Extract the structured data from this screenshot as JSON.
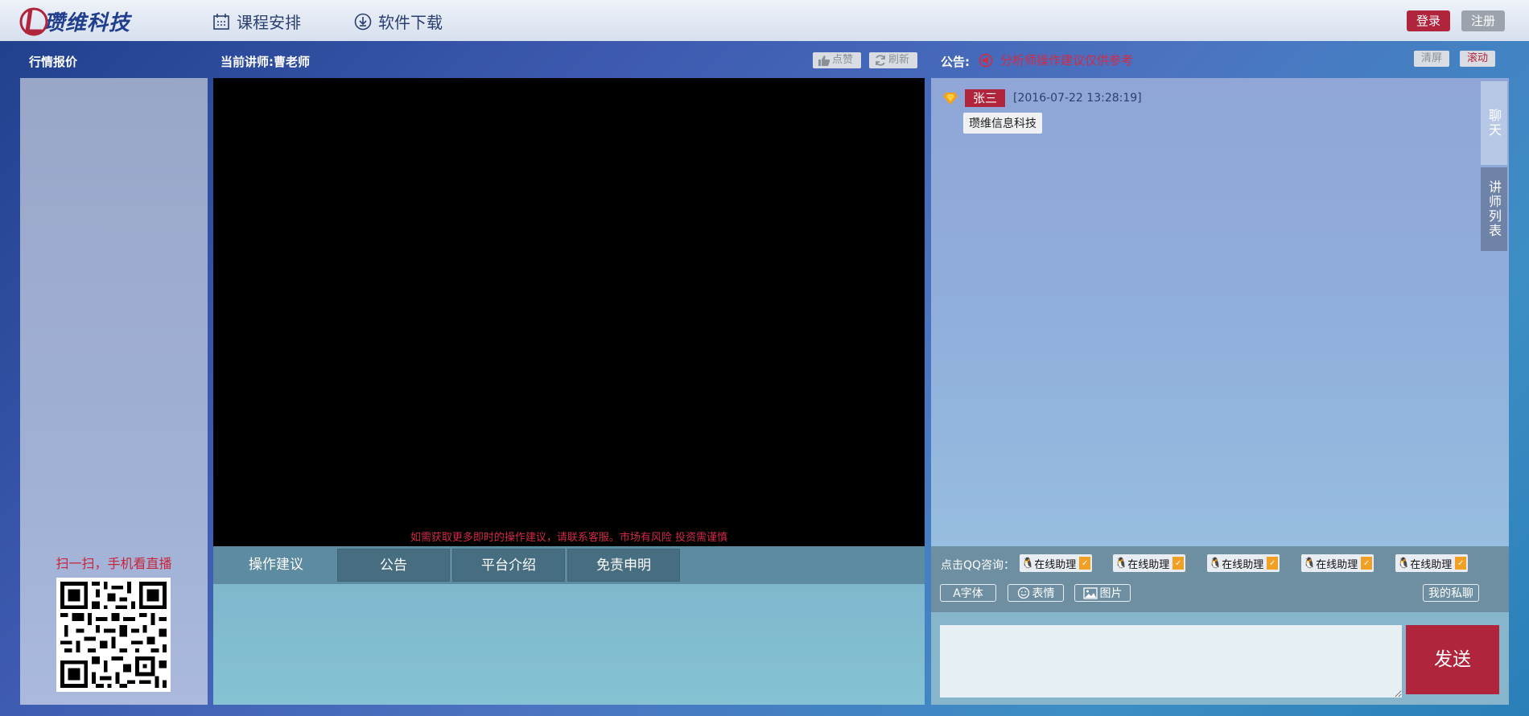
{
  "header": {
    "logo_text": "瓒维科技",
    "nav": [
      {
        "label": "课程安排",
        "icon": "calendar-icon"
      },
      {
        "label": "软件下载",
        "icon": "download-icon"
      }
    ],
    "login_label": "登录",
    "register_label": "注册"
  },
  "left": {
    "title": "行情报价",
    "qr_caption": "扫一扫，手机看直播"
  },
  "center": {
    "teacher_label": "当前讲师:曹老师",
    "like_label": "点赞",
    "refresh_label": "刷新",
    "video_note": "如需获取更多即时的操作建议，请联系客服。市场有风险 投资需谨慎",
    "tabs": [
      {
        "label": "操作建议"
      },
      {
        "label": "公告"
      },
      {
        "label": "平台介绍"
      },
      {
        "label": "免责申明"
      }
    ]
  },
  "right": {
    "notice_label": "公告:",
    "notice_text": "分析师操作建议仅供参考",
    "clear_label": "清屏",
    "scroll_label": "滚动",
    "message": {
      "user": "张三",
      "time": "[2016-07-22 13:28:19]",
      "body": "瓒维信息科技"
    },
    "side_tabs": [
      "聊天",
      "讲师列表"
    ],
    "qq_label": "点击QQ咨询：",
    "qq_items": [
      "在线助理",
      "在线助理",
      "在线助理",
      "在线助理",
      "在线助理"
    ],
    "font_label": "A字体",
    "emoji_label": "表情",
    "image_label": "图片",
    "private_label": "我的私聊",
    "send_label": "发送"
  },
  "colors": {
    "brand_red": "#b0243c",
    "brand_blue": "#1f3f8c"
  }
}
